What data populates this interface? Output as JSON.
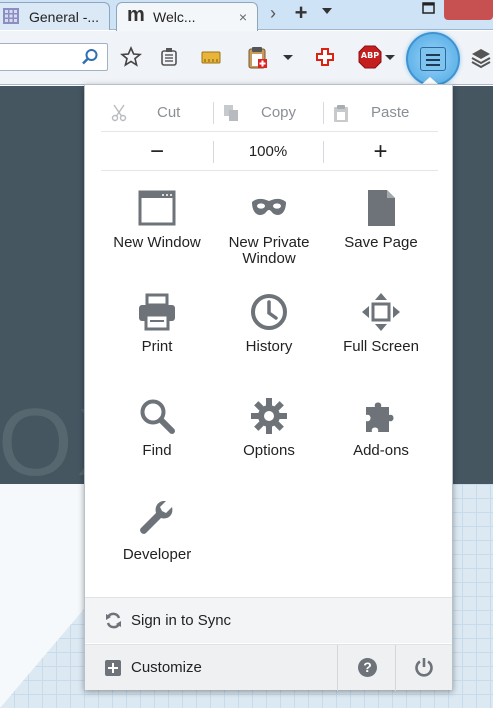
{
  "tabs": [
    {
      "label": "General -...",
      "icon": "grid-favicon",
      "active": false
    },
    {
      "label": "Welc...",
      "icon": "m-favicon",
      "favicon_text": "m",
      "close": "×",
      "active": true
    }
  ],
  "tabstrip": {
    "scroll_glyph": "›",
    "new_tab_glyph": "+"
  },
  "toolbar": {
    "icons": [
      "search-go-icon",
      "bookmark-star-icon",
      "bookmarks-menu-icon",
      "read-later-icon",
      "clipboard-addon-icon",
      "redcross-addon-icon",
      "adblock-plus-icon",
      "menu-hamburger-icon",
      "layers-icon"
    ],
    "abp_label": "ABP"
  },
  "page": {
    "ghost_text": "OX"
  },
  "menu": {
    "edit": {
      "cut": "Cut",
      "copy": "Copy",
      "paste": "Paste"
    },
    "zoom": {
      "out": "−",
      "level": "100%",
      "in": "+"
    },
    "items": [
      {
        "label": "New Window",
        "icon": "new-window-icon"
      },
      {
        "label": "New Private Window",
        "icon": "private-mask-icon"
      },
      {
        "label": "Save Page",
        "icon": "save-page-icon"
      },
      {
        "label": "Print",
        "icon": "printer-icon"
      },
      {
        "label": "History",
        "icon": "clock-icon"
      },
      {
        "label": "Full Screen",
        "icon": "fullscreen-arrows-icon"
      },
      {
        "label": "Find",
        "icon": "magnifier-icon"
      },
      {
        "label": "Options",
        "icon": "gear-icon"
      },
      {
        "label": "Add-ons",
        "icon": "puzzle-icon"
      },
      {
        "label": "Developer",
        "icon": "wrench-icon"
      }
    ],
    "sync": "Sign in to Sync",
    "customize": "Customize",
    "help_glyph": "?"
  },
  "colors": {
    "icon_gray": "#6d7379",
    "page_dark": "#455661",
    "menu_button_blue": "#6ab9ec",
    "close_red": "#c75050"
  }
}
